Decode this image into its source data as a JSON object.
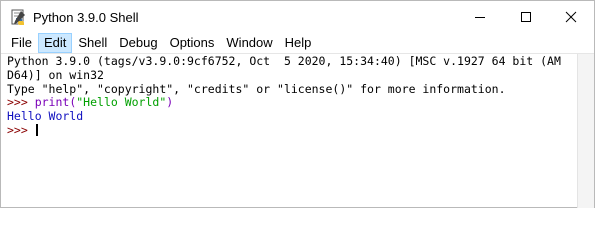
{
  "window": {
    "title": "Python 3.9.0 Shell",
    "icon": "python-idle-icon"
  },
  "menu": [
    "File",
    "Edit",
    "Shell",
    "Debug",
    "Options",
    "Window",
    "Help"
  ],
  "shell": {
    "banner_line1": "Python 3.9.0 (tags/v3.9.0:9cf6752, Oct  5 2020, 15:34:40) [MSC v.1927 64 bit (AM",
    "banner_line2": "D64)] on win32",
    "banner_line3": "Type \"help\", \"copyright\", \"credits\" or \"license()\" for more information.",
    "prompt": ">>> ",
    "cmd_func": "print(",
    "cmd_string": "\"Hello World\"",
    "cmd_close": ")",
    "output": "Hello World",
    "prompt2": ">>> "
  },
  "colors": {
    "prompt": "#8a0000",
    "builtin": "#7a00b8",
    "string": "#00a000",
    "stdout": "#1010c0",
    "menu_highlight": "#cce8ff"
  }
}
